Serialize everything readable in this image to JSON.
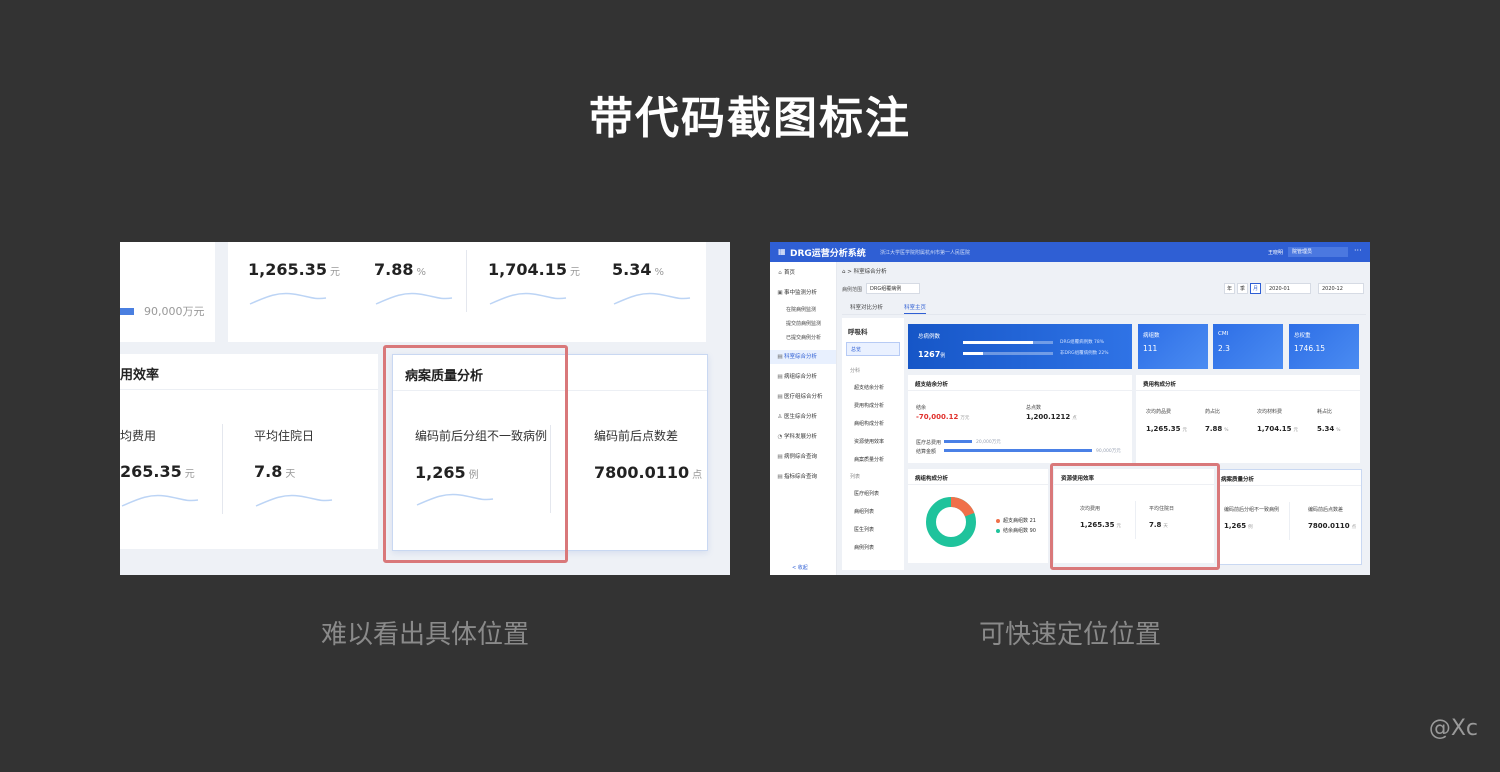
{
  "main_title": "带代码截图标注",
  "left": {
    "caption": "难以看出具体位置",
    "bar_label": "90,000万元",
    "top_values": [
      {
        "value": "1,265.35",
        "unit": "元"
      },
      {
        "value": "7.88",
        "unit": "%"
      },
      {
        "value": "1,704.15",
        "unit": "元"
      },
      {
        "value": "5.34",
        "unit": "%"
      }
    ],
    "efficiency": {
      "title": "用效率",
      "items": [
        {
          "label": "均费用",
          "value": "265.35",
          "unit": "元"
        },
        {
          "label": "平均住院日",
          "value": "7.8",
          "unit": "天"
        }
      ]
    },
    "quality": {
      "title": "病案质量分析",
      "items": [
        {
          "label": "编码前后分组不一致病例",
          "value": "1,265",
          "unit": "例"
        },
        {
          "label": "编码前后点数差",
          "value": "7800.0110",
          "unit": "点"
        }
      ]
    }
  },
  "right": {
    "caption": "可快速定位位置",
    "topbar": {
      "system_name": "DRG运营分析系统",
      "hospital": "浙江大学医学院附属杭州市第一人民医院",
      "user": "王晓明",
      "role": "院管理员",
      "more": "···"
    },
    "sidebar": {
      "items": [
        {
          "label": "首页",
          "icon": "home-icon"
        },
        {
          "label": "事中监测分析",
          "icon": "monitor-icon"
        },
        {
          "label": "科室综合分析",
          "icon": "dept-icon",
          "active": true
        },
        {
          "label": "病组综合分析",
          "icon": "group-icon"
        },
        {
          "label": "医疗组综合分析",
          "icon": "team-icon"
        },
        {
          "label": "医生综合分析",
          "icon": "doctor-icon"
        },
        {
          "label": "学科发展分析",
          "icon": "chart-icon"
        },
        {
          "label": "病例综合查询",
          "icon": "case-icon"
        },
        {
          "label": "指标综合查询",
          "icon": "index-icon"
        }
      ],
      "sub_items": [
        "在院病例监测",
        "提交前病例监测",
        "已提交病例分析"
      ],
      "collapse": "< 收起"
    },
    "breadcrumb": "科室综合分析",
    "filter": {
      "label": "病例范围",
      "select": "DRG组覆病例",
      "period_buttons": [
        "年",
        "季",
        "月"
      ],
      "date_from": "2020-01",
      "date_to": "2020-12"
    },
    "tabs": [
      "科室对比分析",
      "科室主页"
    ],
    "dept_panel": {
      "title": "呼吸科",
      "selected": "总览",
      "group1": "分科",
      "group1_items": [
        "超支结余分析",
        "费用构成分析",
        "病组构成分析",
        "资源使用效率",
        "病案质量分析"
      ],
      "group2": "列表",
      "group2_items": [
        "医疗组列表",
        "病组列表",
        "医生列表",
        "病例列表"
      ]
    },
    "kpi_main": {
      "title": "总病例数",
      "value": "1267",
      "unit": "例",
      "bars": [
        {
          "label": "DRG组覆病例数",
          "pct": "78%",
          "fill": 0.78
        },
        {
          "label": "非DRG组覆病例数",
          "pct": "22%",
          "fill": 0.22
        }
      ]
    },
    "kpis": [
      {
        "title": "病组数",
        "value": "111"
      },
      {
        "title": "CMI",
        "value": "2.3"
      },
      {
        "title": "总权重",
        "value": "1746.15"
      }
    ],
    "surplus": {
      "title": "超支结余分析",
      "balance_label": "结余",
      "balance_value": "-70,000.12",
      "balance_unit": "万元",
      "points_label": "总点数",
      "points_value": "1,200.1212",
      "points_unit": "点",
      "cost_label": "医疗总费用",
      "cost_value": "20,000万元",
      "fund_label": "结算金额",
      "fund_value": "90,000万元"
    },
    "cost": {
      "title": "费用构成分析",
      "items": [
        {
          "label": "次均药品费",
          "value": "1,265.35",
          "unit": "元"
        },
        {
          "label": "药占比",
          "value": "7.88",
          "unit": "%"
        },
        {
          "label": "次均材料费",
          "value": "1,704.15",
          "unit": "元"
        },
        {
          "label": "耗占比",
          "value": "5.34",
          "unit": "%"
        }
      ]
    },
    "group_mix": {
      "title": "病组构成分析",
      "legend": [
        {
          "label": "超支病组数 21",
          "color": "#f0704a"
        },
        {
          "label": "结余病组数 90",
          "color": "#1fc39c"
        }
      ],
      "donut_fraction": 0.19
    },
    "efficiency": {
      "title": "资源使用效率",
      "items": [
        {
          "label": "次均费用",
          "value": "1,265.35",
          "unit": "元"
        },
        {
          "label": "平均住院日",
          "value": "7.8",
          "unit": "天"
        }
      ]
    },
    "quality": {
      "title": "病案质量分析",
      "items": [
        {
          "label": "编码前后分组不一致病例",
          "value": "1,265",
          "unit": "例"
        },
        {
          "label": "编码前后点数差",
          "value": "7800.0110",
          "unit": "点"
        }
      ]
    }
  },
  "watermark": "@Xc",
  "colors": {
    "background": "#333333",
    "primary": "#2f5fd4",
    "highlight_box": "#d9787a"
  }
}
